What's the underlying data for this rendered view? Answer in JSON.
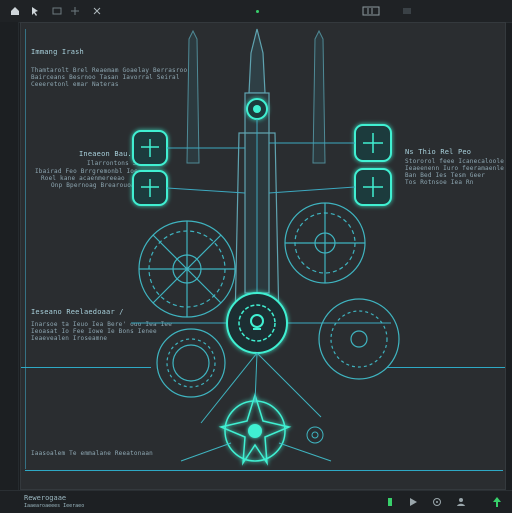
{
  "colors": {
    "background": "#1b1e21",
    "canvas": "#2a2d30",
    "accent": "#2fb7d6",
    "glow": "#3ff0d2",
    "text": "#8fa8b3",
    "green": "#38d06b"
  },
  "icons": {
    "top_left": [
      "home-icon",
      "cursor-icon",
      "panel-icon",
      "sparkle-icon",
      "expand-icon"
    ],
    "top_right": [
      "frame-icon",
      "layers-icon"
    ],
    "bottom_right": [
      "green-indicator-icon",
      "play-icon",
      "settings-icon",
      "person-icon",
      "arrow-up-icon"
    ]
  },
  "labels": {
    "top_left_title": "Immang Irash",
    "top_left_lines": [
      "Thamtarolt Brel Reaemam Goaelay Berrasroo",
      "Bairceans Besrnoo Tasan Iavorral Seiral",
      "Ceeeretonl emar Nateras"
    ],
    "left_mid_title": "Ineaeon Bau.",
    "left_mid_lines": [
      "Ilarrontons Seoe",
      "Ibairad Feo Brrgremonbl Ioe",
      "Roel kane acaenmereeao",
      "Onp Bpernoag Brearouoaer"
    ],
    "right_mid_title": "Ns Thio Rel Peo",
    "right_mid_lines": [
      "Stororol feee Icanecaloole",
      "Ieaeenenn Iuro feeramaenle",
      "Ban Bed Ies Tesm Geer",
      "Tos Rotnsoe Iea Rn"
    ],
    "left_lower_title": "Ieseano Reelaedoaar /",
    "left_lower_lines": [
      "Inarsoe ta Ieuo Iea Bere' ouo Iea Iee",
      "Ieoasat Io Fee Iowe Ie Bons Ienee",
      "Ieaevealen Iroseamne"
    ],
    "bottom_caption": "Iaasoalem Te emmalane Reeatonaan",
    "status_left": "Rewerogaae",
    "status_sub": "Iaaearoaeees   Ieeraeo"
  }
}
